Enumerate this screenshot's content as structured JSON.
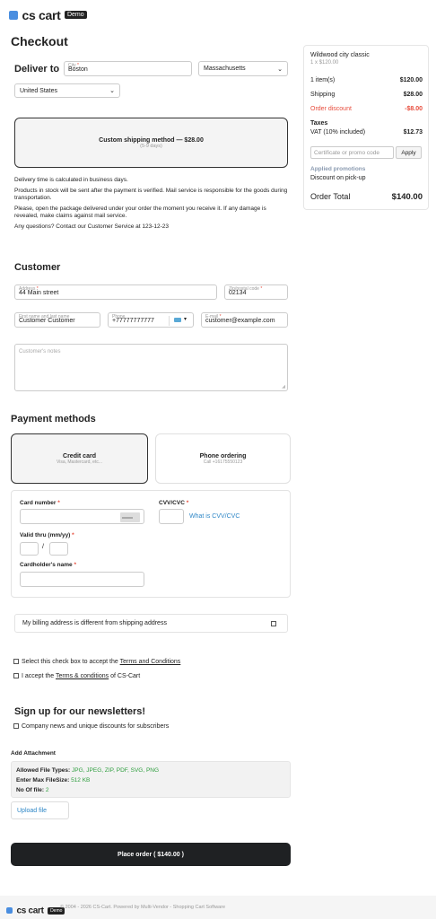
{
  "header": {
    "logo_text": "cs cart",
    "badge": "Demo"
  },
  "page_title": "Checkout",
  "deliver": {
    "heading": "Deliver to",
    "city_label": "City",
    "city_value": "Boston",
    "state_value": "Massachusetts",
    "country_value": "United States"
  },
  "shipping": {
    "title": "Custom shipping method — $28.00",
    "sub": "(5-9 days)"
  },
  "info": [
    "Delivery time is calculated in business days.",
    "Products in stock will be sent after the payment is verified. Mail service is responsible for the goods during transportation.",
    "Please, open the package delivered under your order the moment you receive it. If any damage is revealed, make claims against mail service.",
    "Any questions? Contact our Customer Service at 123-12-23"
  ],
  "customer": {
    "heading": "Customer",
    "address_label": "Address",
    "address_value": "44 Main street",
    "zip_label": "Zip/postal code",
    "zip_value": "02134",
    "name_label": "First name and last name",
    "name_value": "Customer Customer",
    "phone_label": "Phone",
    "phone_value": "+77777777777",
    "email_label": "E-mail",
    "email_value": "customer@example.com",
    "notes_placeholder": "Customer's notes"
  },
  "payment": {
    "heading": "Payment methods",
    "methods": [
      {
        "title": "Credit card",
        "sub": "Visa, Mastercard, etc..."
      },
      {
        "title": "Phone ordering",
        "sub": "Call +16175550123"
      }
    ],
    "card_number_label": "Card number",
    "cvv_label": "CVV/CVC",
    "cvv_link": "What is CVV/CVC",
    "valid_label": "Valid thru (mm/yy)",
    "slash": "/",
    "holder_label": "Cardholder's name"
  },
  "billing_different": "My billing address is different from shipping address",
  "terms": {
    "line1_pre": "Select this check box to accept the ",
    "line1_link": "Terms and Conditions",
    "line2_pre": "I accept the ",
    "line2_link": "Terms & conditions",
    "line2_post": " of CS-Cart"
  },
  "newsletter": {
    "heading": "Sign up for our newsletters!",
    "option": "Company news and unique discounts for subscribers"
  },
  "attachment": {
    "heading": "Add Attachment",
    "types_label": "Allowed File Types:",
    "types_value": "JPG, JPEG, ZIP, PDF, SVG, PNG",
    "size_label": "Enter Max FileSize:",
    "size_value": "512 KB",
    "count_label": "No Of file:",
    "count_value": "2",
    "upload_label": "Upload file"
  },
  "place_order": "Place order ( $140.00 )",
  "summary": {
    "product_name": "Wildwood city classic",
    "product_qty": "1 x $120.00",
    "items_label": "1 item(s)",
    "items_value": "$120.00",
    "shipping_label": "Shipping",
    "shipping_value": "$28.00",
    "discount_label": "Order discount",
    "discount_value": "-$8.00",
    "taxes_label": "Taxes",
    "vat_label": "VAT (10% included)",
    "vat_value": "$12.73",
    "promo_placeholder": "Certificate or promo code",
    "apply_label": "Apply",
    "promotions_label": "Applied promotions",
    "promotion_item": "Discount on pick-up",
    "total_label": "Order Total",
    "total_value": "$140.00"
  },
  "footer": {
    "logo_text": "cs cart",
    "badge": "Demo",
    "copyright": "© 2004 - 2026 CS-Cart.  Powered by Multi-Vendor - Shopping Cart Software"
  },
  "colors": {
    "accent_link": "#2d86c6",
    "discount_red": "#e74c3c",
    "button_dark": "#1f2123",
    "attachment_green": "#2e9e3e"
  }
}
